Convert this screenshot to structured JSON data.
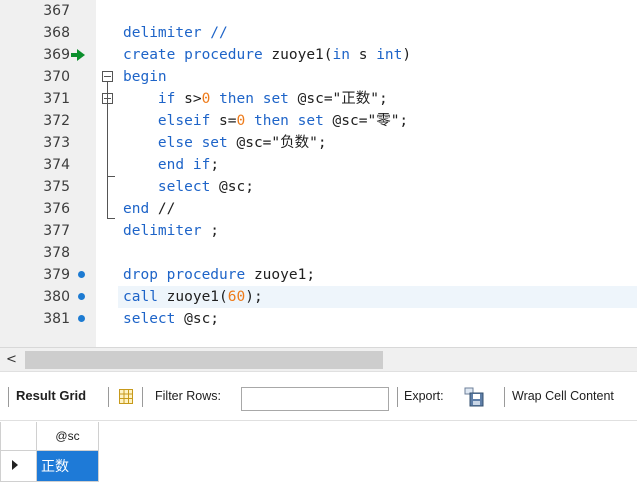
{
  "editor": {
    "lines": [
      {
        "num": "367",
        "code": ""
      },
      {
        "num": "368",
        "code": "delimiter //"
      },
      {
        "num": "369",
        "code": "create procedure zuoye1(in s int)"
      },
      {
        "num": "370",
        "code": "begin"
      },
      {
        "num": "371",
        "code": "    if s>0 then set @sc=\"正数\";"
      },
      {
        "num": "372",
        "code": "    elseif s=0 then set @sc=\"零\";"
      },
      {
        "num": "373",
        "code": "    else set @sc=\"负数\";"
      },
      {
        "num": "374",
        "code": "    end if;"
      },
      {
        "num": "375",
        "code": "    select @sc;"
      },
      {
        "num": "376",
        "code": "end //"
      },
      {
        "num": "377",
        "code": "delimiter ;"
      },
      {
        "num": "378",
        "code": ""
      },
      {
        "num": "379",
        "code": "drop procedure zuoye1;"
      },
      {
        "num": "380",
        "code": "call zuoye1(60);"
      },
      {
        "num": "381",
        "code": "select @sc;"
      }
    ]
  },
  "scrollbar": {
    "left_arrow": "<"
  },
  "toolbar": {
    "result_grid": "Result Grid",
    "filter_rows": "Filter Rows:",
    "filter_value": "",
    "export": "Export:",
    "wrap_cell": "Wrap Cell Content"
  },
  "result": {
    "column": "@sc",
    "rows": [
      "正数"
    ]
  },
  "colors": {
    "keyword": "#1e64c8",
    "number": "#ee7b1a",
    "selection": "#1e7ad7",
    "exec_arrow": "#0b8f2c",
    "stmt_dot": "#1d7bd2"
  }
}
